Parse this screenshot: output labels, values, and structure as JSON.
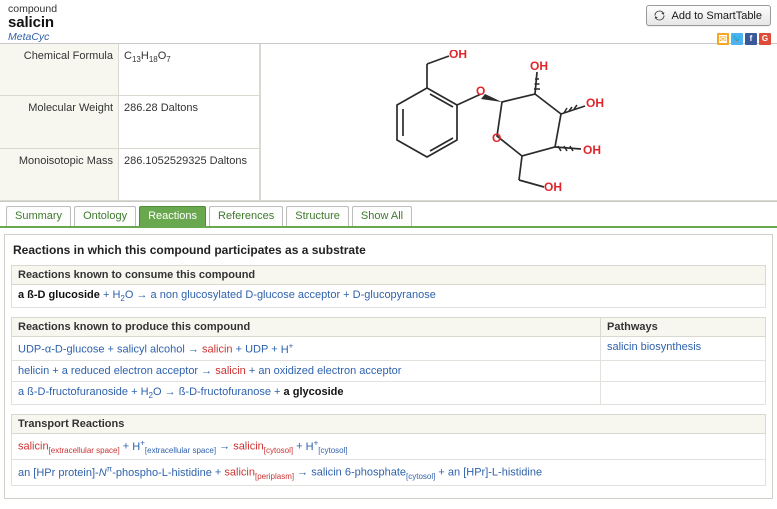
{
  "header": {
    "kind": "compound",
    "title": "salicin",
    "database": "MetaCyc",
    "smarttable_button": "Add to SmartTable",
    "social": [
      {
        "name": "email-share-icon",
        "glyph": "✉"
      },
      {
        "name": "twitter-share-icon",
        "glyph": "ᴠ"
      },
      {
        "name": "facebook-share-icon",
        "glyph": "f"
      },
      {
        "name": "googleplus-share-icon",
        "glyph": "G⁺"
      }
    ]
  },
  "properties": [
    {
      "label": "Chemical Formula",
      "value": "C13H18O7",
      "formula": [
        [
          "C",
          ""
        ],
        [
          "",
          "13"
        ],
        [
          "H",
          ""
        ],
        [
          "",
          "18"
        ],
        [
          "O",
          ""
        ],
        [
          "",
          "7"
        ]
      ]
    },
    {
      "label": "Molecular Weight",
      "value": "286.28 Daltons"
    },
    {
      "label": "Monoisotopic Mass",
      "value": "286.1052529325 Daltons"
    }
  ],
  "structure": {
    "name": "salicin-structure-diagram",
    "labels": [
      "OH",
      "OH",
      "OH",
      "OH",
      "OH",
      "O",
      "O"
    ]
  },
  "tabs": [
    {
      "label": "Summary",
      "active": false
    },
    {
      "label": "Ontology",
      "active": false
    },
    {
      "label": "Reactions",
      "active": true
    },
    {
      "label": "References",
      "active": false
    },
    {
      "label": "Structure",
      "active": false
    },
    {
      "label": "Show All",
      "active": false
    }
  ],
  "panel": {
    "title": "Reactions in which this compound participates as a substrate",
    "sections": [
      {
        "heading": "Reactions known to consume this compound",
        "pathways_header": null,
        "rows": [
          {
            "parts": [
              {
                "t": "a ß-D glucoside",
                "c": "plain"
              },
              {
                "t": " + ",
                "c": "arrow"
              },
              {
                "t": "H2O",
                "c": "lnk",
                "sub": "2",
                "base": "H",
                "tail": "O"
              },
              {
                "t": " → ",
                "c": "arrow"
              },
              {
                "t": "a non glucosylated D-glucose acceptor",
                "c": "lnk"
              },
              {
                "t": " + ",
                "c": "arrow"
              },
              {
                "t": "D-glucopyranose",
                "c": "lnk"
              }
            ],
            "pathway": ""
          }
        ]
      },
      {
        "heading": "Reactions known to produce this compound",
        "pathways_header": "Pathways",
        "rows": [
          {
            "parts": [
              {
                "t": "UDP-α-D-glucose",
                "c": "lnk"
              },
              {
                "t": " + ",
                "c": "arrow"
              },
              {
                "t": "salicyl alcohol",
                "c": "lnk"
              },
              {
                "t": " → ",
                "c": "arrow"
              },
              {
                "t": "salicin",
                "c": "lnk-red"
              },
              {
                "t": " + ",
                "c": "arrow"
              },
              {
                "t": "UDP",
                "c": "lnk"
              },
              {
                "t": " + ",
                "c": "arrow"
              },
              {
                "t": "H+",
                "c": "lnk",
                "sup": "+",
                "base": "H"
              }
            ],
            "pathway": "salicin biosynthesis"
          },
          {
            "parts": [
              {
                "t": "helicin",
                "c": "lnk"
              },
              {
                "t": " + ",
                "c": "arrow"
              },
              {
                "t": "a reduced electron acceptor",
                "c": "lnk"
              },
              {
                "t": " → ",
                "c": "arrow"
              },
              {
                "t": "salicin",
                "c": "lnk-red"
              },
              {
                "t": " + ",
                "c": "arrow"
              },
              {
                "t": "an oxidized electron acceptor",
                "c": "lnk"
              }
            ],
            "pathway": ""
          },
          {
            "parts": [
              {
                "t": "a ß-D-fructofuranoside",
                "c": "lnk"
              },
              {
                "t": " + ",
                "c": "arrow"
              },
              {
                "t": "H2O",
                "c": "lnk",
                "sub": "2",
                "base": "H",
                "tail": "O"
              },
              {
                "t": " → ",
                "c": "arrow"
              },
              {
                "t": "ß-D-fructofuranose",
                "c": "lnk"
              },
              {
                "t": " + ",
                "c": "arrow"
              },
              {
                "t": "a glycoside",
                "c": "plain"
              }
            ],
            "pathway": ""
          }
        ]
      },
      {
        "heading": "Transport Reactions",
        "pathways_header": null,
        "rows": [
          {
            "parts": [
              {
                "t": "salicin",
                "c": "lnk-red",
                "comp": "[extracellular space]"
              },
              {
                "t": " + ",
                "c": "arrow"
              },
              {
                "t": "H",
                "c": "lnk",
                "sup": "+",
                "base": "H",
                "comp": "[extracellular space]"
              },
              {
                "t": " → ",
                "c": "arrow"
              },
              {
                "t": "salicin",
                "c": "lnk-red",
                "comp": "[cytosol]"
              },
              {
                "t": " + ",
                "c": "arrow"
              },
              {
                "t": "H",
                "c": "lnk",
                "sup": "+",
                "base": "H",
                "comp": "[cytosol]"
              }
            ],
            "pathway": ""
          },
          {
            "parts": [
              {
                "t": "an [HPr protein]-Nπ-phospho-L-histidine",
                "c": "lnk"
              },
              {
                "t": " + ",
                "c": "arrow"
              },
              {
                "t": "salicin",
                "c": "lnk-red",
                "comp": "[periplasm]"
              },
              {
                "t": " → ",
                "c": "arrow"
              },
              {
                "t": "salicin 6-phosphate",
                "c": "lnk",
                "comp": "[cytosol]"
              },
              {
                "t": " + ",
                "c": "arrow"
              },
              {
                "t": "an [HPr]-L-histidine",
                "c": "lnk"
              }
            ],
            "pathway": ""
          }
        ]
      }
    ]
  },
  "colors": {
    "link_blue": "#2f62ad",
    "compound_red": "#cc3333",
    "tab_green": "#6aa84f",
    "panel_header_bg": "#f7f7f0"
  }
}
